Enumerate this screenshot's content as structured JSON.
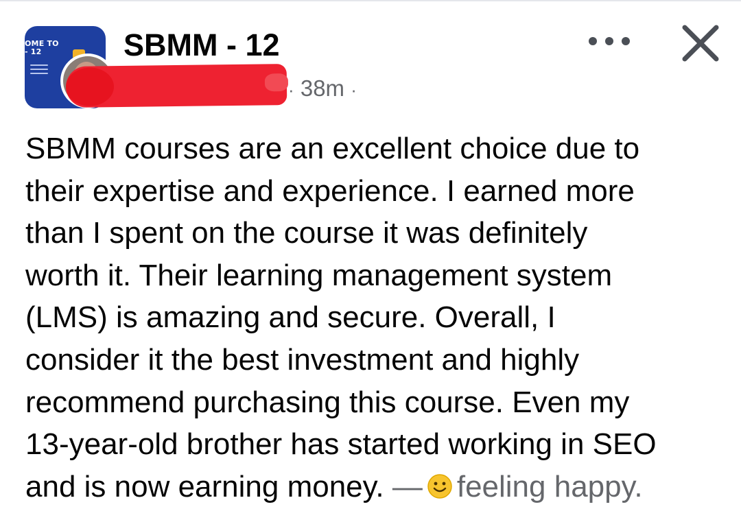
{
  "header": {
    "group_name": "SBMM - 12",
    "group_avatar": {
      "banner_line_1": "OME TO",
      "banner_line_2": "- 12"
    },
    "time_ago": "38m",
    "separator_left": "·",
    "separator_right": "·",
    "author_name_redacted": true
  },
  "actions": {
    "more_icon": "more-horizontal-icon",
    "close_icon": "close-icon"
  },
  "post": {
    "lines": [
      "SBMM courses are an excellent choice due to",
      "their expertise and experience. I earned more",
      "than I spent on the course it was definitely",
      "worth it. Their learning management system",
      "(LMS) is amazing and secure. Overall, I",
      "consider it the best investment and highly",
      "recommend purchasing this course. Even my",
      "13-year-old brother has started working in SEO"
    ],
    "last_line_text": "and is now earning money.",
    "dash": "—",
    "feeling_icon": "smiley-face-icon",
    "feeling_text": "feeling happy."
  },
  "colors": {
    "primary_text": "#050505",
    "secondary_text": "#65676b",
    "redaction": "#ee2231",
    "group_avatar_bg": "#1e3fa0",
    "emoji_yellow": "#f7c42e"
  }
}
